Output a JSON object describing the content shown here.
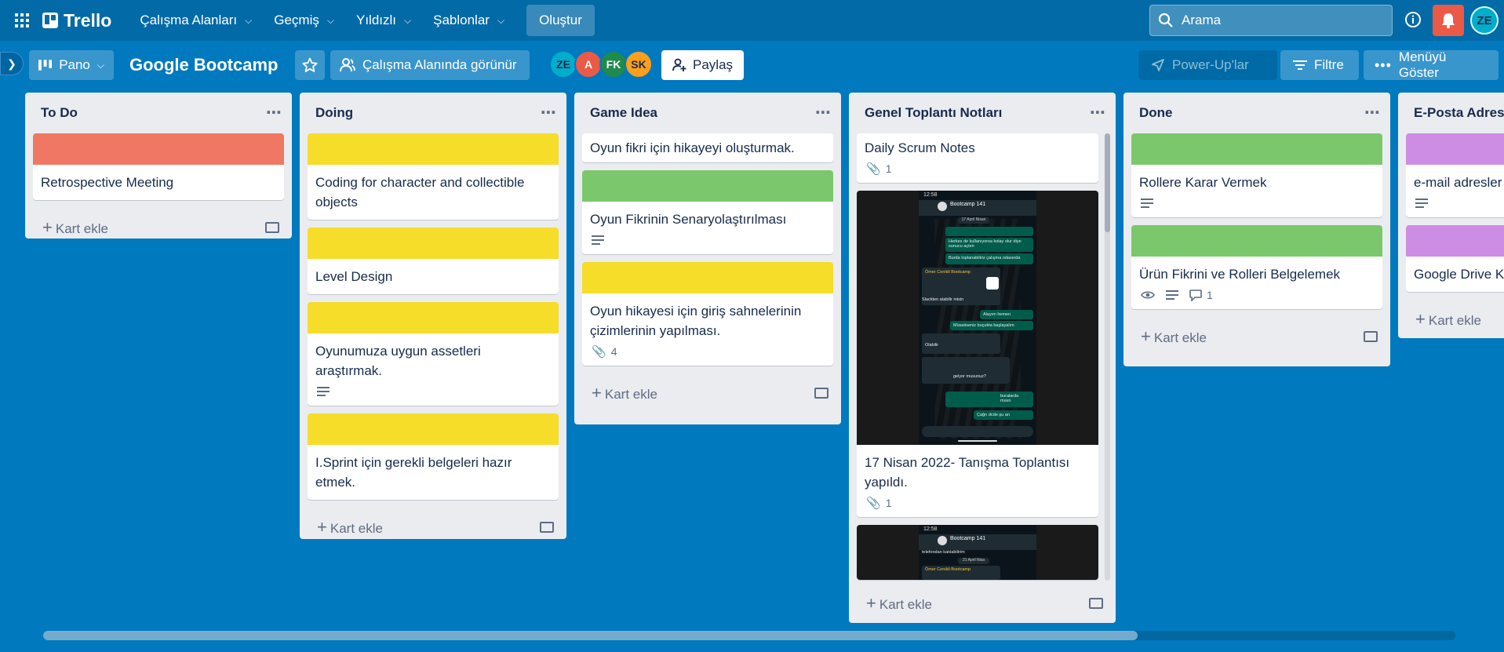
{
  "header": {
    "logo": "Trello",
    "nav": [
      "Çalışma Alanları",
      "Geçmiş",
      "Yıldızlı",
      "Şablonlar"
    ],
    "create_label": "Oluştur",
    "search_placeholder": "Arama",
    "user_initials": "ZE"
  },
  "board": {
    "view_label": "Pano",
    "title": "Google Bootcamp",
    "visibility_label": "Çalışma Alanında görünür",
    "members": [
      {
        "initials": "ZE",
        "color": "#00aecc"
      },
      {
        "initials": "A",
        "color": "#eb5a46"
      },
      {
        "initials": "FK",
        "color": "#1f8a4c"
      },
      {
        "initials": "SK",
        "color": "#ff9f1a"
      }
    ],
    "share_label": "Paylaş",
    "powerups_label": "Power-Up'lar",
    "filter_label": "Filtre",
    "menu_label": "Menüyü Göster",
    "add_card_label": "Kart ekle"
  },
  "colors": {
    "red": "#f07763",
    "yellow": "#f5dd29",
    "green": "#7bc86c",
    "purple": "#cd8de5"
  },
  "lists": [
    {
      "title": "To Do",
      "cards": [
        {
          "cover": "red",
          "text": "Retrospective Meeting"
        }
      ]
    },
    {
      "title": "Doing",
      "cards": [
        {
          "cover": "yellow",
          "text": "Coding for character and collectible objects"
        },
        {
          "cover": "yellow",
          "text": "Level Design"
        },
        {
          "cover": "yellow",
          "text": "Oyunumuza uygun assetleri araştırmak.",
          "description": true
        },
        {
          "cover": "yellow",
          "text": "I.Sprint için gerekli belgeleri hazır etmek."
        }
      ]
    },
    {
      "title": "Game Idea",
      "cards": [
        {
          "text": "Oyun fikri için hikayeyi oluşturmak."
        },
        {
          "cover": "green",
          "text": "Oyun Fikrinin Senaryolaştırılması",
          "description": true
        },
        {
          "cover": "yellow",
          "text": "Oyun hikayesi için giriş sahnelerinin çizimlerinin yapılması.",
          "attachments": "4"
        }
      ]
    },
    {
      "title": "Genel Toplantı Notları",
      "cards": [
        {
          "text": "Daily Scrum Notes",
          "attachments": "1"
        },
        {
          "image": "phone-screenshot",
          "text": "17 Nisan 2022- Tanışma Toplantısı yapıldı.",
          "attachments": "1"
        },
        {
          "image": "phone-screenshot-partial"
        }
      ]
    },
    {
      "title": "Done",
      "cards": [
        {
          "cover": "green",
          "text": "Rollere Karar Vermek",
          "description": true
        },
        {
          "cover": "green",
          "text": "Ürün Fikrini ve Rolleri Belgelemek",
          "watching": true,
          "description": true,
          "comments": "1"
        }
      ]
    },
    {
      "title": "E-Posta Adresl",
      "cards": [
        {
          "cover": "purple",
          "text": "e-mail adresler",
          "description": true
        },
        {
          "cover": "purple",
          "text": "Google Drive K"
        }
      ]
    }
  ],
  "phone": {
    "time": "12:58",
    "chat_name": "Bootcamp 141",
    "date_chip": "17 April Nisan",
    "date_chip_2": "21 April Nisa",
    "sender": "Ömer Cenikli Bootcamp",
    "messages": [
      "Herkes de kullanıyorsa kolay olur diye sunucu açtım",
      "Burda toplanabiliriz çalışma odasında",
      "Slackten atabilir misin",
      "Alayım hemen",
      "Müsaitseniz buçukta başlayalım",
      "Olabilir",
      "gelyor musunuz?",
      "buralarda mısın",
      "Çağrı dcde şu an",
      "telefondan katılabilirim"
    ]
  }
}
